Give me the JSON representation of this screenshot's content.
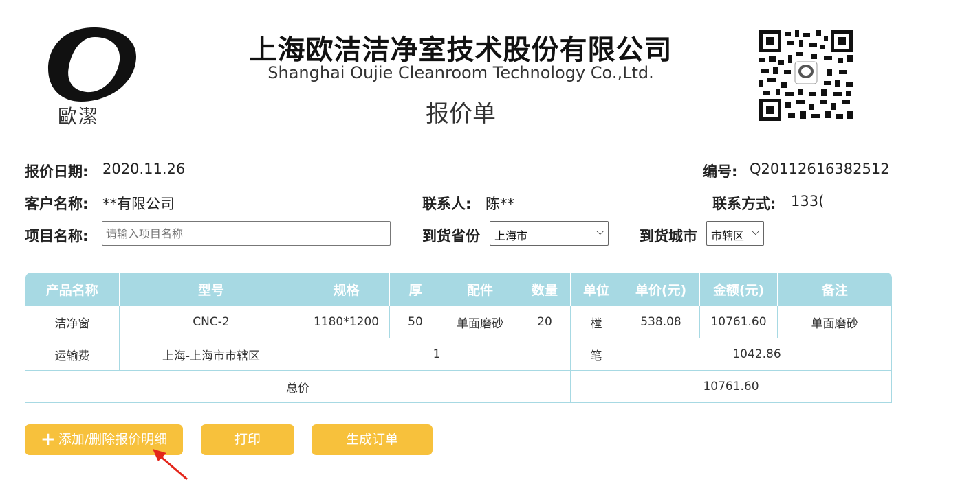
{
  "header": {
    "logo_text": "歐潔",
    "company_cn": "上海欧洁洁净室技术股份有限公司",
    "company_en": "Shanghai Oujie Cleanroom Technology Co.,Ltd.",
    "doc_title": "报价单"
  },
  "info": {
    "date_label": "报价日期:",
    "date_value": "2020.11.26",
    "number_label": "编号:",
    "number_value": "Q20112616382512",
    "customer_label": "客户名称:",
    "customer_value": "**有限公司",
    "contact_label": "联系人:",
    "contact_value": "陈**",
    "phone_label": "联系方式:",
    "phone_value": "133(",
    "project_label": "项目名称:",
    "project_placeholder": "请输入项目名称",
    "province_label": "到货省份",
    "province_value": "上海市",
    "city_label": "到货城市",
    "city_value": "市辖区"
  },
  "table": {
    "headers": [
      "产品名称",
      "型号",
      "规格",
      "厚",
      "配件",
      "数量",
      "单位",
      "单价(元)",
      "金额(元)",
      "备注"
    ],
    "row1": [
      "洁净窗",
      "CNC-2",
      "1180*1200",
      "50",
      "单面磨砂",
      "20",
      "樘",
      "538.08",
      "10761.60",
      "单面磨砂"
    ],
    "row2": {
      "name": "运输费",
      "model": "上海-上海市市辖区",
      "qty": "1",
      "unit": "笔",
      "amount": "1042.86"
    },
    "total": {
      "label": "总价",
      "amount": "10761.60"
    }
  },
  "buttons": {
    "add_plus": "+",
    "add_label": "添加/删除报价明细",
    "print_label": "打印",
    "order_label": "生成订单"
  },
  "colors": {
    "header_bg": "#a7d9e3",
    "button_bg": "#f7c13c",
    "arrow": "#e3261b"
  }
}
